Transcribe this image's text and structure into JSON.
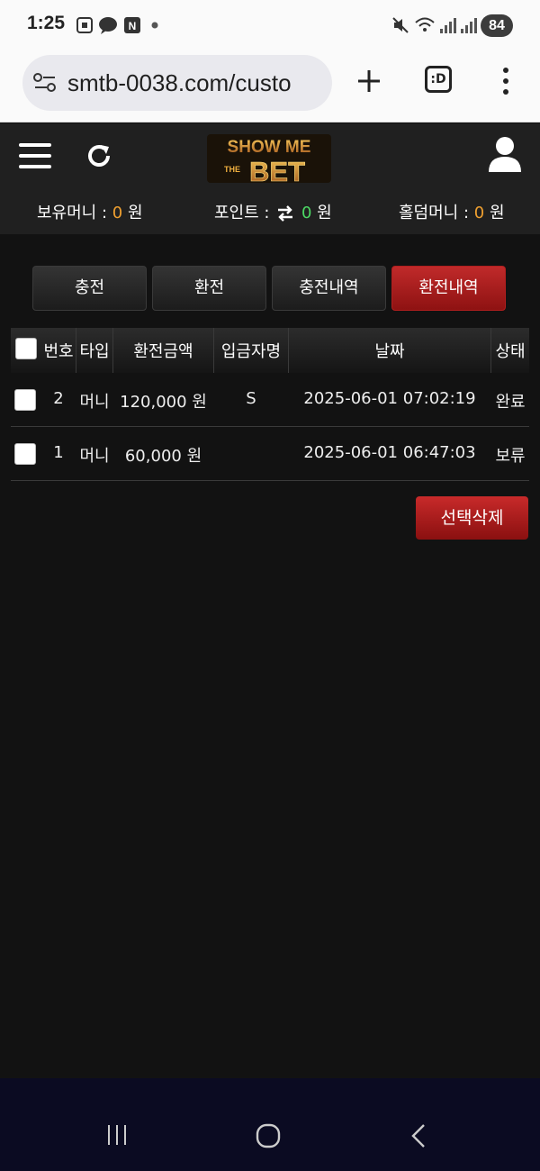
{
  "status_bar": {
    "time": "1:25",
    "battery": "84"
  },
  "browser": {
    "url": "smtb-0038.com/custo",
    "tabs_label": ":D"
  },
  "header": {
    "logo_text_top": "SHOW ME",
    "logo_text_mid": "THE",
    "logo_text_bottom": "BET"
  },
  "balances": {
    "money_label": "보유머니 :",
    "money_value": "0",
    "point_label": "포인트 :",
    "point_value": "0",
    "holdem_label": "홀덤머니 :",
    "holdem_value": "0",
    "unit": "원"
  },
  "tabs": [
    {
      "label": "충전"
    },
    {
      "label": "환전"
    },
    {
      "label": "충전내역"
    },
    {
      "label": "환전내역"
    }
  ],
  "table": {
    "headers": [
      "번호",
      "타입",
      "환전금액",
      "입금자명",
      "날짜",
      "상태"
    ],
    "rows": [
      {
        "no": "2",
        "type": "머니",
        "amount": "120,000 원",
        "name": "S",
        "date": "2025-06-01 07:02:19",
        "status": "완료"
      },
      {
        "no": "1",
        "type": "머니",
        "amount": "60,000 원",
        "name": "",
        "date": "2025-06-01 06:47:03",
        "status": "보류"
      }
    ]
  },
  "delete_button": "선택삭제",
  "colors": {
    "accent_red": "#b01e1e",
    "amount_orange": "#f0a030",
    "point_green": "#4cd964"
  }
}
